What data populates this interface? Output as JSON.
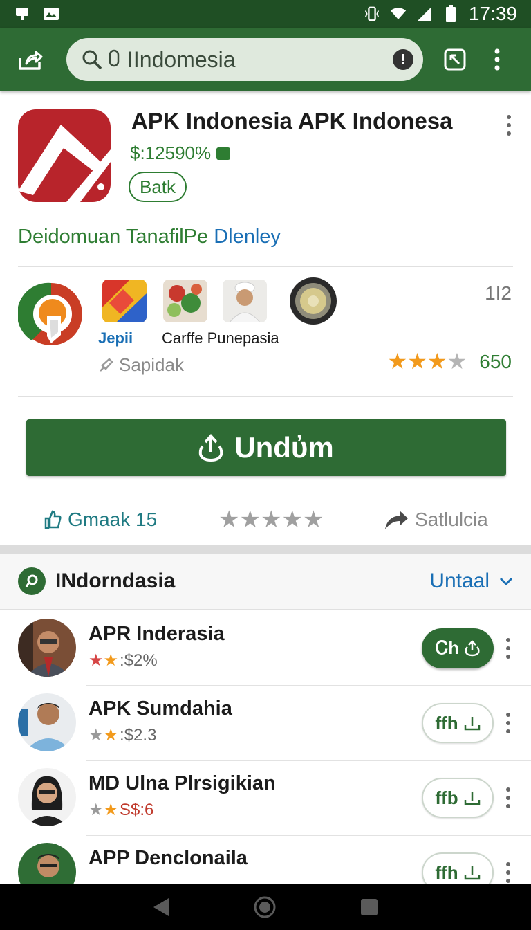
{
  "status_bar": {
    "time": "17:39",
    "left_icons": [
      "notification-icon",
      "photo-icon"
    ],
    "right_icons": [
      "vibrate-icon",
      "wifi-icon",
      "signal-icon",
      "battery-icon"
    ]
  },
  "toolbar": {
    "search_value": "IIndomesia",
    "share_icon": "share-icon",
    "alert_icon_label": "!",
    "menu_icon": "more-vert-icon"
  },
  "app": {
    "title": "APK Indonesia APK Indonesa",
    "price": "$:12590%",
    "badge": "Batk",
    "developer_green": "Deidomuan TanafilPe ",
    "developer_blue": "Dlenley"
  },
  "related": {
    "count": "1I2",
    "label_jepii": "Jepii",
    "label_carffe": "Carffe Punepasia",
    "label_sapidak": "Sapidak",
    "rating_value": "650",
    "stars_filled": 3,
    "stars_total": 4
  },
  "install": {
    "label": "Undὐm"
  },
  "actions": {
    "left_label": "Gmaak 15",
    "stars_total": 5,
    "right_label": "Satlulcia"
  },
  "section": {
    "title": "INdorndasia",
    "filter_label": "Untaal"
  },
  "list": [
    {
      "name": "APR Inderasia",
      "rating_text": ":$2%",
      "button_label": "Ꮯh",
      "button_style": "filled"
    },
    {
      "name": "APK Sumdahia",
      "rating_text": ":$2.3",
      "button_label": "ffh",
      "button_style": "outline"
    },
    {
      "name": "MD Ulna Plrsigikian",
      "rating_text": "S$:6",
      "button_label": "ffb",
      "button_style": "outline"
    },
    {
      "name": "APP Denclonaila",
      "rating_text": "",
      "button_label": "ffh",
      "button_style": "outline"
    }
  ],
  "colors": {
    "primary_green": "#2e6b34",
    "status_green": "#1f4f24",
    "accent_blue": "#1a6fb5",
    "star_orange": "#f29a1c",
    "brand_red": "#b8242b"
  }
}
